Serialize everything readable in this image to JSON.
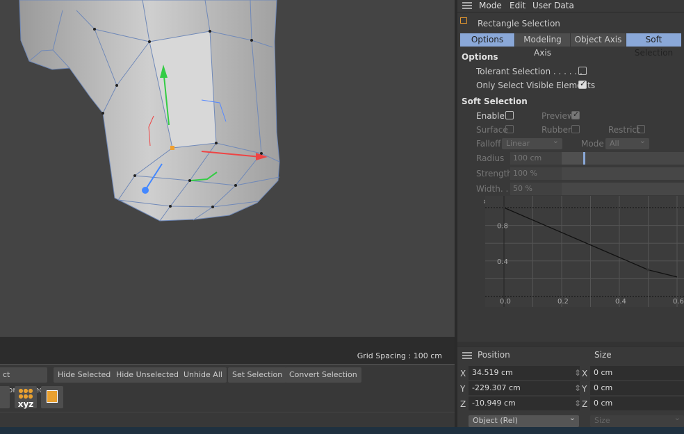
{
  "viewport": {
    "grid_spacing": "Grid Spacing : 100 cm"
  },
  "toolbar": {
    "buttons": [
      "ct Connected",
      "Hide Selected",
      "Hide Unselected",
      "Unhide All",
      "Set Selection",
      "Convert Selection"
    ],
    "icons": [
      "move-tool-icon",
      "point-xyz-icon",
      "cube-icon"
    ],
    "xyz_label": "xyz"
  },
  "attributes": {
    "menu": [
      "Mode",
      "Edit",
      "User Data"
    ],
    "tool_name": "Rectangle Selection",
    "tabs": [
      {
        "label": "Options",
        "active": true
      },
      {
        "label": "Modeling Axis",
        "active": false
      },
      {
        "label": "Object Axis",
        "active": false
      },
      {
        "label": "Soft Selection",
        "active": true
      }
    ],
    "options": {
      "title": "Options",
      "tolerant": "Tolerant Selection . . . . . . .",
      "tolerant_checked": false,
      "visible": "Only Select Visible Elements",
      "visible_checked": true
    },
    "soft": {
      "title": "Soft Selection",
      "enable": "Enable",
      "preview": "Preview",
      "surface": "Surface",
      "rubber": "Rubber",
      "restrict": "Restrict",
      "falloff": "Falloff",
      "falloff_value": "Linear",
      "mode": "Mode",
      "mode_value": "All",
      "radius": "Radius",
      "radius_value": "100 cm",
      "strength": "Strength",
      "strength_value": "100 %",
      "width": "Width. .",
      "width_value": "50 %"
    }
  },
  "chart_data": {
    "type": "line",
    "x_ticks": [
      "0.0",
      "0.2",
      "0.4",
      "0.6"
    ],
    "y_ticks": [
      "0.4",
      "0.8"
    ],
    "x": [
      0,
      0.5,
      0.6
    ],
    "y": [
      1.0,
      0.3,
      0.22
    ],
    "grid": true
  },
  "coordinates": {
    "position_label": "Position",
    "size_label": "Size",
    "axes": [
      "X",
      "Y",
      "Z"
    ],
    "position": [
      "34.519 cm",
      "-229.307 cm",
      "-10.949 cm"
    ],
    "size": [
      "0 cm",
      "0 cm",
      "0 cm"
    ],
    "mode": "Object (Rel)",
    "size_mode": "Size"
  }
}
